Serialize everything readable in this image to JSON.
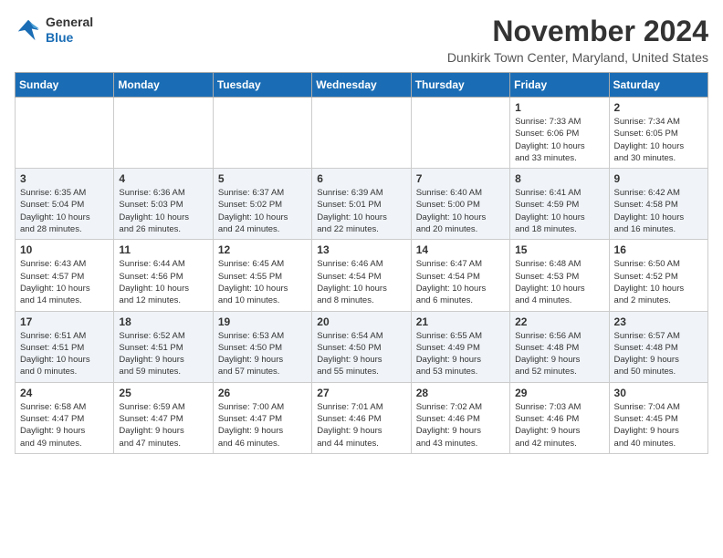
{
  "logo": {
    "line1": "General",
    "line2": "Blue"
  },
  "title": "November 2024",
  "location": "Dunkirk Town Center, Maryland, United States",
  "weekdays": [
    "Sunday",
    "Monday",
    "Tuesday",
    "Wednesday",
    "Thursday",
    "Friday",
    "Saturday"
  ],
  "weeks": [
    [
      {
        "day": "",
        "info": ""
      },
      {
        "day": "",
        "info": ""
      },
      {
        "day": "",
        "info": ""
      },
      {
        "day": "",
        "info": ""
      },
      {
        "day": "",
        "info": ""
      },
      {
        "day": "1",
        "info": "Sunrise: 7:33 AM\nSunset: 6:06 PM\nDaylight: 10 hours\nand 33 minutes."
      },
      {
        "day": "2",
        "info": "Sunrise: 7:34 AM\nSunset: 6:05 PM\nDaylight: 10 hours\nand 30 minutes."
      }
    ],
    [
      {
        "day": "3",
        "info": "Sunrise: 6:35 AM\nSunset: 5:04 PM\nDaylight: 10 hours\nand 28 minutes."
      },
      {
        "day": "4",
        "info": "Sunrise: 6:36 AM\nSunset: 5:03 PM\nDaylight: 10 hours\nand 26 minutes."
      },
      {
        "day": "5",
        "info": "Sunrise: 6:37 AM\nSunset: 5:02 PM\nDaylight: 10 hours\nand 24 minutes."
      },
      {
        "day": "6",
        "info": "Sunrise: 6:39 AM\nSunset: 5:01 PM\nDaylight: 10 hours\nand 22 minutes."
      },
      {
        "day": "7",
        "info": "Sunrise: 6:40 AM\nSunset: 5:00 PM\nDaylight: 10 hours\nand 20 minutes."
      },
      {
        "day": "8",
        "info": "Sunrise: 6:41 AM\nSunset: 4:59 PM\nDaylight: 10 hours\nand 18 minutes."
      },
      {
        "day": "9",
        "info": "Sunrise: 6:42 AM\nSunset: 4:58 PM\nDaylight: 10 hours\nand 16 minutes."
      }
    ],
    [
      {
        "day": "10",
        "info": "Sunrise: 6:43 AM\nSunset: 4:57 PM\nDaylight: 10 hours\nand 14 minutes."
      },
      {
        "day": "11",
        "info": "Sunrise: 6:44 AM\nSunset: 4:56 PM\nDaylight: 10 hours\nand 12 minutes."
      },
      {
        "day": "12",
        "info": "Sunrise: 6:45 AM\nSunset: 4:55 PM\nDaylight: 10 hours\nand 10 minutes."
      },
      {
        "day": "13",
        "info": "Sunrise: 6:46 AM\nSunset: 4:54 PM\nDaylight: 10 hours\nand 8 minutes."
      },
      {
        "day": "14",
        "info": "Sunrise: 6:47 AM\nSunset: 4:54 PM\nDaylight: 10 hours\nand 6 minutes."
      },
      {
        "day": "15",
        "info": "Sunrise: 6:48 AM\nSunset: 4:53 PM\nDaylight: 10 hours\nand 4 minutes."
      },
      {
        "day": "16",
        "info": "Sunrise: 6:50 AM\nSunset: 4:52 PM\nDaylight: 10 hours\nand 2 minutes."
      }
    ],
    [
      {
        "day": "17",
        "info": "Sunrise: 6:51 AM\nSunset: 4:51 PM\nDaylight: 10 hours\nand 0 minutes."
      },
      {
        "day": "18",
        "info": "Sunrise: 6:52 AM\nSunset: 4:51 PM\nDaylight: 9 hours\nand 59 minutes."
      },
      {
        "day": "19",
        "info": "Sunrise: 6:53 AM\nSunset: 4:50 PM\nDaylight: 9 hours\nand 57 minutes."
      },
      {
        "day": "20",
        "info": "Sunrise: 6:54 AM\nSunset: 4:50 PM\nDaylight: 9 hours\nand 55 minutes."
      },
      {
        "day": "21",
        "info": "Sunrise: 6:55 AM\nSunset: 4:49 PM\nDaylight: 9 hours\nand 53 minutes."
      },
      {
        "day": "22",
        "info": "Sunrise: 6:56 AM\nSunset: 4:48 PM\nDaylight: 9 hours\nand 52 minutes."
      },
      {
        "day": "23",
        "info": "Sunrise: 6:57 AM\nSunset: 4:48 PM\nDaylight: 9 hours\nand 50 minutes."
      }
    ],
    [
      {
        "day": "24",
        "info": "Sunrise: 6:58 AM\nSunset: 4:47 PM\nDaylight: 9 hours\nand 49 minutes."
      },
      {
        "day": "25",
        "info": "Sunrise: 6:59 AM\nSunset: 4:47 PM\nDaylight: 9 hours\nand 47 minutes."
      },
      {
        "day": "26",
        "info": "Sunrise: 7:00 AM\nSunset: 4:47 PM\nDaylight: 9 hours\nand 46 minutes."
      },
      {
        "day": "27",
        "info": "Sunrise: 7:01 AM\nSunset: 4:46 PM\nDaylight: 9 hours\nand 44 minutes."
      },
      {
        "day": "28",
        "info": "Sunrise: 7:02 AM\nSunset: 4:46 PM\nDaylight: 9 hours\nand 43 minutes."
      },
      {
        "day": "29",
        "info": "Sunrise: 7:03 AM\nSunset: 4:46 PM\nDaylight: 9 hours\nand 42 minutes."
      },
      {
        "day": "30",
        "info": "Sunrise: 7:04 AM\nSunset: 4:45 PM\nDaylight: 9 hours\nand 40 minutes."
      }
    ]
  ]
}
